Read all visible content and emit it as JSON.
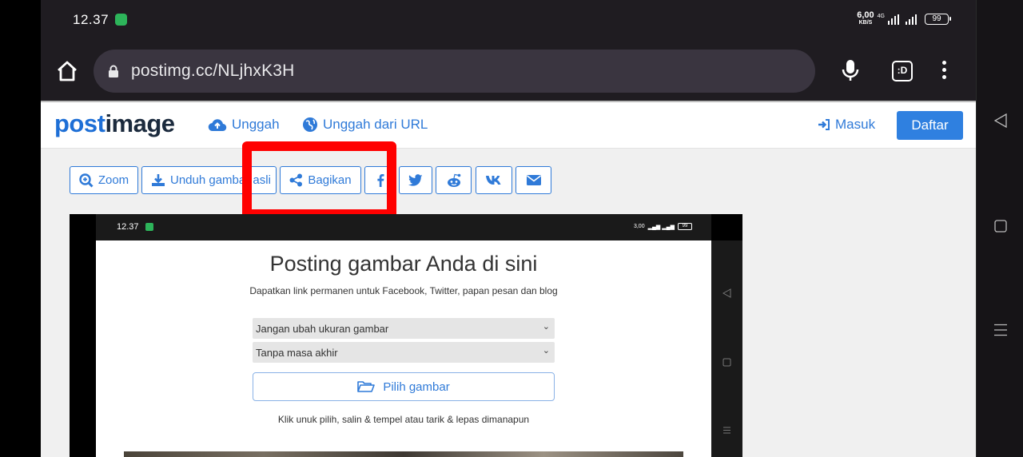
{
  "statusbar": {
    "time": "12.37",
    "net_speed": "6,00",
    "net_unit": "KB/S",
    "net_type": "4G",
    "battery": "99"
  },
  "browser": {
    "url": "postimg.cc/NLjhxK3H",
    "tabs_label": ":D"
  },
  "site": {
    "logo_part1": "post",
    "logo_part2": "image",
    "nav": {
      "upload": "Unggah",
      "upload_url": "Unggah dari URL",
      "login": "Masuk",
      "signup": "Daftar"
    },
    "toolbar": {
      "zoom": "Zoom",
      "download": "Unduh gambar asli",
      "share": "Bagikan"
    },
    "colors": {
      "accent": "#2f7ad8",
      "highlight": "#ff0000"
    }
  },
  "embedded": {
    "time": "12.37",
    "net_speed": "3,00",
    "battery": "99",
    "title": "Posting gambar Anda di sini",
    "subtitle": "Dapatkan link permanen untuk Facebook, Twitter, papan pesan dan blog",
    "select_resize": "Jangan ubah ukuran gambar",
    "select_expiry": "Tanpa masa akhir",
    "choose_button": "Pilih gambar",
    "hint": "Klik unuk pilih, salin & tempel atau tarik & lepas dimanapun"
  }
}
